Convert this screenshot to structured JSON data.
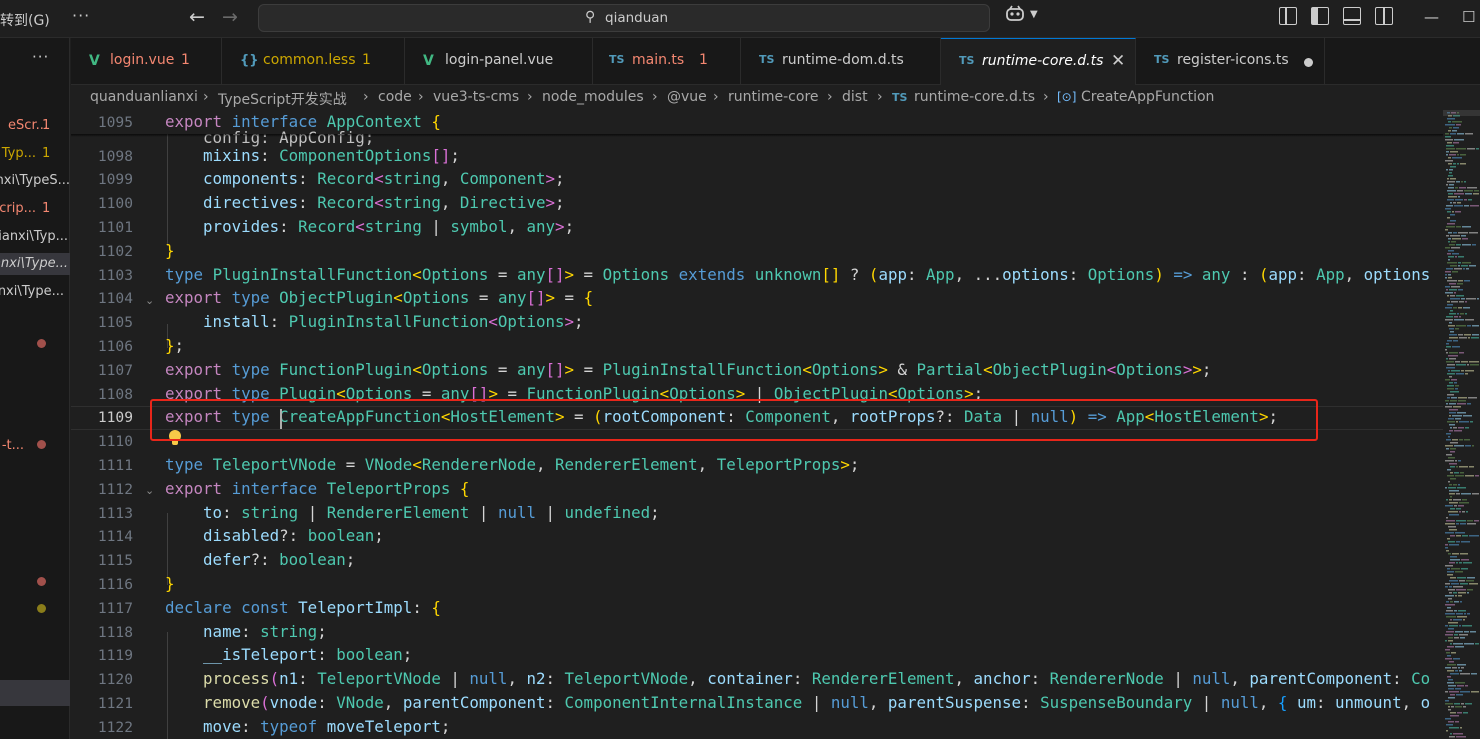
{
  "titlebar": {
    "goto_label": "转到(G)",
    "more_glyph": "···",
    "back_glyph": "←",
    "forward_glyph": "→",
    "search_icon": "⚲",
    "search_text": "qianduan",
    "copilot_icon": "copilot-icon",
    "layout_icons": [
      "layout-customize-icon",
      "toggle-primary-sidebar-icon",
      "toggle-panel-icon",
      "toggle-secondary-sidebar-icon"
    ],
    "minimize_glyph": "—",
    "maximize_glyph": "☐",
    "close_glyph": "✕"
  },
  "sidebar": {
    "more_glyph": "···",
    "items": [
      {
        "text": "eScr...",
        "count": "1",
        "color": "#f48771"
      },
      {
        "text": "Typ...",
        "count": "1",
        "color": "#cca700"
      },
      {
        "text": "nxi\\TypeS...",
        "count": "",
        "color": "#cccccc"
      },
      {
        "text": "crip...",
        "count": "1",
        "color": "#f48771"
      },
      {
        "text": "lianxi\\Typ...",
        "count": "",
        "color": "#cccccc"
      },
      {
        "text": "lanxi\\Type...",
        "count": "",
        "color": "#cccccc",
        "selected": true
      },
      {
        "text": "nxi\\Type...",
        "count": "",
        "color": "#cccccc"
      }
    ],
    "extra_label": "-t...",
    "dot_colors": [
      "#a1504b",
      "#a1504b",
      "#a1504b",
      "#8a7d1a"
    ]
  },
  "tabs": [
    {
      "icon": "V",
      "icon_color": "#41b883",
      "label": "login.vue",
      "count": "1",
      "label_color": "#f48771"
    },
    {
      "icon": "{}",
      "icon_color": "#519aba",
      "label": "common.less",
      "count": "1",
      "label_color": "#cca700"
    },
    {
      "icon": "V",
      "icon_color": "#41b883",
      "label": "login-panel.vue",
      "count": "",
      "label_color": "#cccccc"
    },
    {
      "icon": "TS",
      "icon_color": "#519aba",
      "label": "main.ts",
      "count": "1",
      "label_color": "#f48771"
    },
    {
      "icon": "TS",
      "icon_color": "#519aba",
      "label": "runtime-dom.d.ts",
      "count": "",
      "label_color": "#cccccc"
    },
    {
      "icon": "TS",
      "icon_color": "#519aba",
      "label": "runtime-core.d.ts",
      "count": "",
      "label_color": "#ffffff",
      "active": true,
      "italic": true
    },
    {
      "icon": "TS",
      "icon_color": "#519aba",
      "label": "register-icons.ts",
      "count": "",
      "label_color": "#cccccc",
      "dirty": true
    }
  ],
  "breadcrumb": [
    "quanduanlianxi",
    "›",
    "TypeScript开发实战",
    "›",
    "code",
    "›",
    "vue3-ts-cms",
    "›",
    "node_modules",
    "›",
    "@vue",
    "›",
    "runtime-core",
    "›",
    "dist",
    "›",
    "TS",
    "runtime-core.d.ts",
    "›",
    "[⊙]",
    "CreateAppFunction"
  ],
  "editor": {
    "current_line": "1109",
    "line_numbers": [
      "1095",
      "1098",
      "1099",
      "1100",
      "1101",
      "1102",
      "1103",
      "1104",
      "1105",
      "1106",
      "1107",
      "1108",
      "1109",
      "1110",
      "1111",
      "1112",
      "1113",
      "1114",
      "1115",
      "1116",
      "1117",
      "1118",
      "1119",
      "1120",
      "1121",
      "1122"
    ],
    "sticky_partial_text": "    config: AppConfig;"
  }
}
